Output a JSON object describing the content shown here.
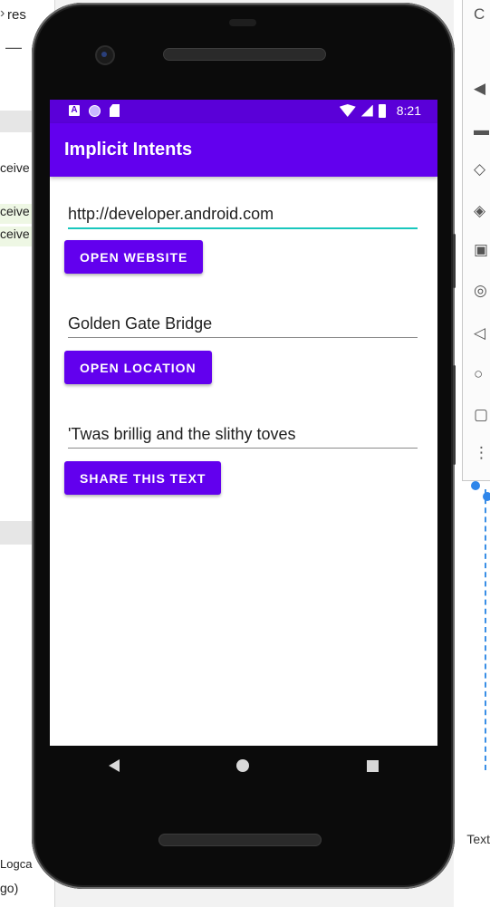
{
  "ide": {
    "tab_label": "res",
    "code_lines": [
      "ceive",
      "ceive",
      "ceive"
    ],
    "bottom_tab": "Logca",
    "bottom_line": "go)",
    "right_panel_label": "Text",
    "toolbar_glyphs": [
      "C",
      "◀",
      "▬",
      "◇",
      "◈",
      "▣",
      "◎",
      "◁",
      "○",
      "▢",
      "⋮"
    ]
  },
  "status_bar": {
    "time": "8:21",
    "icons": [
      "a-icon",
      "circle-icon",
      "sd-card-icon",
      "wifi-icon",
      "signal-icon",
      "battery-icon"
    ]
  },
  "app_bar": {
    "title": "Implicit Intents"
  },
  "website": {
    "value": "http://developer.android.com",
    "button_label": "OPEN WEBSITE"
  },
  "location": {
    "value": "Golden Gate Bridge",
    "button_label": "OPEN LOCATION"
  },
  "share": {
    "value": "'Twas brillig and the slithy toves",
    "button_label": "SHARE THIS TEXT"
  },
  "colors": {
    "primary": "#6200ee",
    "primary_dark": "#5a00d8",
    "accent": "#19c7bd"
  }
}
